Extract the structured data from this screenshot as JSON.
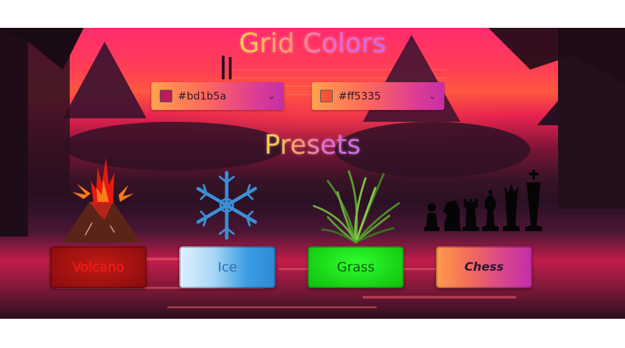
{
  "window": {
    "grid_title": "Grid Colors",
    "presets_title": "Presets"
  },
  "pickers": [
    {
      "value": "#bd1b5a",
      "swatch_color": "#bd1b5a",
      "icon": "chevron-down-icon"
    },
    {
      "value": "#ff5335",
      "swatch_color": "#ff5335",
      "icon": "chevron-down-icon"
    }
  ],
  "presets": [
    {
      "label": "Volcano",
      "icon": "volcano-icon"
    },
    {
      "label": "Ice",
      "icon": "snowflake-icon"
    },
    {
      "label": "Grass",
      "icon": "grass-icon"
    },
    {
      "label": "Chess",
      "icon": "chess-pieces-icon"
    }
  ],
  "colors": {
    "sunset_top": "#ff2a6d",
    "sunset_mid": "#ff5740",
    "volcano_button": "#a81412",
    "ice_button": "#3c9de3",
    "grass_button": "#1fe01c",
    "chess_button": "#e0408f"
  }
}
